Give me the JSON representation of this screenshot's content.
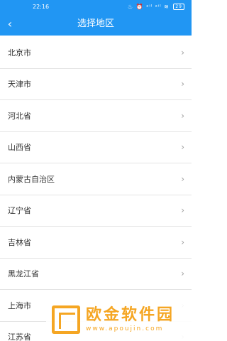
{
  "status": {
    "time": "22:16",
    "icons": "♨ ⏰ ᵃⁱˡ ᵃⁱˡ ≋",
    "battery": "29"
  },
  "header": {
    "title": "选择地区",
    "back_icon": "‹"
  },
  "regions": [
    {
      "label": "北京市"
    },
    {
      "label": "天津市"
    },
    {
      "label": "河北省"
    },
    {
      "label": "山西省"
    },
    {
      "label": "内蒙古自治区"
    },
    {
      "label": "辽宁省"
    },
    {
      "label": "吉林省"
    },
    {
      "label": "黑龙江省"
    },
    {
      "label": "上海市"
    },
    {
      "label": "江苏省"
    }
  ],
  "chevron": "›",
  "watermark": {
    "name": "欧金软件园",
    "url": "www.apoujin.com"
  },
  "colors": {
    "accent": "#2196f3",
    "watermark": "#f5a623"
  }
}
